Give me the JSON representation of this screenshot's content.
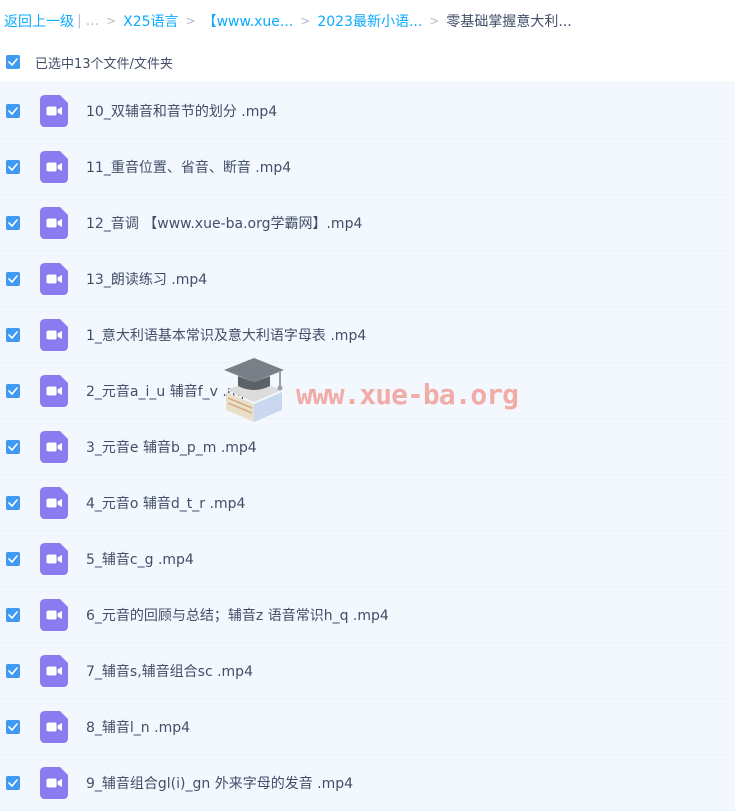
{
  "breadcrumb": {
    "back_label": "返回上一级",
    "divider": "|",
    "ellipsis": "...",
    "separator": ">",
    "items": [
      "X25语言",
      "【www.xue...",
      "2023最新小语...",
      "零基础掌握意大利..."
    ]
  },
  "selection": {
    "label": "已选中13个文件/文件夹",
    "checked": true
  },
  "files": [
    {
      "name": "10_双辅音和音节的划分 .mp4",
      "checked": true
    },
    {
      "name": "11_重音位置、省音、断音 .mp4",
      "checked": true
    },
    {
      "name": "12_音调 【www.xue-ba.org学霸网】.mp4",
      "checked": true
    },
    {
      "name": "13_朗读练习 .mp4",
      "checked": true
    },
    {
      "name": "1_意大利语基本常识及意大利语字母表 .mp4",
      "checked": true
    },
    {
      "name": "2_元音a_i_u 辅音f_v .mp4",
      "checked": true
    },
    {
      "name": "3_元音e 辅音b_p_m .mp4",
      "checked": true
    },
    {
      "name": "4_元音o 辅音d_t_r .mp4",
      "checked": true
    },
    {
      "name": "5_辅音c_g .mp4",
      "checked": true
    },
    {
      "name": "6_元音的回顾与总结；辅音z 语音常识h_q .mp4",
      "checked": true
    },
    {
      "name": "7_辅音s,辅音组合sc .mp4",
      "checked": true
    },
    {
      "name": "8_辅音l_n .mp4",
      "checked": true
    },
    {
      "name": "9_辅音组合gl(i)_gn 外来字母的发音 .mp4",
      "checked": true
    }
  ],
  "watermark": {
    "text": "www.xue-ba.org"
  },
  "icons": {
    "checkbox": "checkmark-icon",
    "file": "video-file-icon",
    "watermark": "graduation-cap-book-icon"
  },
  "colors": {
    "link": "#09aaff",
    "checkbox": "#3f9af0",
    "video_icon": "#8a7cf0",
    "row_bg": "#f3f8ff",
    "text": "#424e67",
    "watermark": "#f06e5f"
  }
}
